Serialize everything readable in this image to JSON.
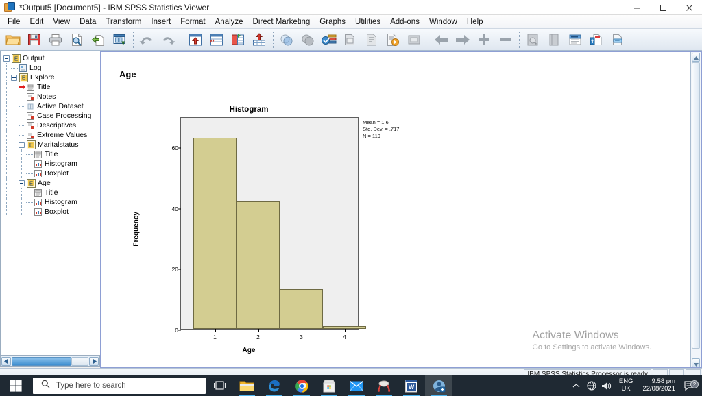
{
  "window": {
    "title": "*Output5 [Document5] - IBM SPSS Statistics Viewer",
    "app_icon": "spss-icon",
    "minimize_label": "—",
    "maximize_label": "☐",
    "close_label": "✕"
  },
  "menu": {
    "items": [
      {
        "label": "File",
        "accel": "F"
      },
      {
        "label": "Edit",
        "accel": "E"
      },
      {
        "label": "View",
        "accel": "V"
      },
      {
        "label": "Data",
        "accel": "D"
      },
      {
        "label": "Transform",
        "accel": "T"
      },
      {
        "label": "Insert",
        "accel": "I"
      },
      {
        "label": "Format",
        "accel": "o"
      },
      {
        "label": "Analyze",
        "accel": "A"
      },
      {
        "label": "Direct Marketing",
        "accel": "M"
      },
      {
        "label": "Graphs",
        "accel": "G"
      },
      {
        "label": "Utilities",
        "accel": "U"
      },
      {
        "label": "Add-ons",
        "accel": "n"
      },
      {
        "label": "Window",
        "accel": "W"
      },
      {
        "label": "Help",
        "accel": "H"
      }
    ]
  },
  "toolbar": {
    "buttons": [
      {
        "name": "open-file-icon",
        "title": "Open data document"
      },
      {
        "name": "save-icon",
        "title": "Save this document"
      },
      {
        "name": "print-icon",
        "title": "Print"
      },
      {
        "name": "print-preview-icon",
        "title": "Print preview"
      },
      {
        "name": "export-icon",
        "title": "Export"
      },
      {
        "name": "recall-dialog-icon",
        "title": "Recall recently used dialogs"
      },
      {
        "name": "undo-icon",
        "title": "Undo"
      },
      {
        "name": "redo-icon",
        "title": "Redo"
      },
      {
        "name": "goto-case-icon",
        "title": "Go to case"
      },
      {
        "name": "goto-variable-icon",
        "title": "Go to variable"
      },
      {
        "name": "variables-icon",
        "title": "Variables"
      },
      {
        "name": "insert-cases-icon",
        "title": "Insert cases"
      },
      {
        "name": "find-icon",
        "title": "Find"
      },
      {
        "name": "select-cases-icon",
        "title": "Select cases"
      },
      {
        "name": "value-labels-icon",
        "title": "Value labels"
      },
      {
        "name": "split-file-icon",
        "title": "Split file"
      },
      {
        "name": "weight-cases-icon",
        "title": "Weight cases"
      },
      {
        "name": "run-icon",
        "title": "Run"
      },
      {
        "name": "dialog-recall-icon",
        "title": "Dialog recall"
      },
      {
        "name": "back-arrow-icon",
        "title": "Back"
      },
      {
        "name": "forward-arrow-icon",
        "title": "Forward"
      },
      {
        "name": "expand-icon",
        "title": "Expand"
      },
      {
        "name": "collapse-icon",
        "title": "Collapse"
      },
      {
        "name": "preview-icon",
        "title": "Show/hide"
      },
      {
        "name": "book-icon",
        "title": "Hide"
      },
      {
        "name": "insert-text-icon",
        "title": "Insert new text"
      },
      {
        "name": "insert-title-icon",
        "title": "Insert new title"
      },
      {
        "name": "insert-page-break-icon",
        "title": "Insert page break"
      }
    ]
  },
  "outline": {
    "nodes": [
      {
        "label": "Output",
        "depth": 0,
        "icon": "output-icon",
        "expander": "open",
        "selected": false
      },
      {
        "label": "Log",
        "depth": 1,
        "icon": "log-icon",
        "expander": "none",
        "selected": false
      },
      {
        "label": "Explore",
        "depth": 1,
        "icon": "explore-icon",
        "expander": "open",
        "selected": false
      },
      {
        "label": "Title",
        "depth": 2,
        "icon": "title-icon",
        "expander": "none",
        "selected": true
      },
      {
        "label": "Notes",
        "depth": 2,
        "icon": "notes-icon",
        "expander": "none",
        "selected": false
      },
      {
        "label": "Active Dataset",
        "depth": 2,
        "icon": "dataset-icon",
        "expander": "none",
        "selected": false
      },
      {
        "label": "Case Processing",
        "depth": 2,
        "icon": "table-icon",
        "expander": "none",
        "selected": false
      },
      {
        "label": "Descriptives",
        "depth": 2,
        "icon": "table-icon",
        "expander": "none",
        "selected": false
      },
      {
        "label": "Extreme Values",
        "depth": 2,
        "icon": "table-icon",
        "expander": "none",
        "selected": false
      },
      {
        "label": "Maritalstatus",
        "depth": 2,
        "icon": "explore-icon",
        "expander": "open",
        "selected": false
      },
      {
        "label": "Title",
        "depth": 3,
        "icon": "title-icon",
        "expander": "none",
        "selected": false
      },
      {
        "label": "Histogram",
        "depth": 3,
        "icon": "chart-icon",
        "expander": "none",
        "selected": false
      },
      {
        "label": "Boxplot",
        "depth": 3,
        "icon": "chart-icon",
        "expander": "none",
        "selected": false
      },
      {
        "label": "Age",
        "depth": 2,
        "icon": "explore-icon",
        "expander": "open",
        "selected": false
      },
      {
        "label": "Title",
        "depth": 3,
        "icon": "title-icon",
        "expander": "none",
        "selected": false
      },
      {
        "label": "Histogram",
        "depth": 3,
        "icon": "chart-icon",
        "expander": "none",
        "selected": false
      },
      {
        "label": "Boxplot",
        "depth": 3,
        "icon": "chart-icon",
        "expander": "none",
        "selected": false
      }
    ]
  },
  "document": {
    "heading": "Age"
  },
  "chart_data": {
    "type": "bar",
    "title": "Histogram",
    "xlabel": "Age",
    "ylabel": "Frequency",
    "categories": [
      "1",
      "2",
      "3",
      "4"
    ],
    "values": [
      63,
      42,
      13,
      1
    ],
    "ylim": [
      0,
      70
    ],
    "yticks": [
      0,
      20,
      40,
      60
    ],
    "xticks": [
      "1",
      "2",
      "3",
      "4"
    ],
    "grid": false,
    "bar_color": "#d3cd91",
    "bar_border_color": "#6e6a43",
    "plot_background": "#efefef",
    "annotations": {
      "mean": "Mean = 1.6",
      "std_dev": "Std. Dev. = .717",
      "n": "N = 119"
    }
  },
  "watermark": {
    "line1": "Activate Windows",
    "line2": "Go to Settings to activate Windows."
  },
  "statusbar": {
    "message": "IBM SPSS Statistics Processor is ready"
  },
  "taskbar": {
    "start_icon": "windows-start-icon",
    "search_placeholder": "Type here to search",
    "search_icon": "search-icon",
    "items": [
      {
        "name": "task-view-icon",
        "label": "Task View"
      },
      {
        "name": "file-explorer-icon",
        "label": "File Explorer"
      },
      {
        "name": "edge-icon",
        "label": "Microsoft Edge"
      },
      {
        "name": "chrome-icon",
        "label": "Google Chrome"
      },
      {
        "name": "microsoft-store-icon",
        "label": "Microsoft Store"
      },
      {
        "name": "mail-icon",
        "label": "Mail"
      },
      {
        "name": "snip-sketch-icon",
        "label": "Snip & Sketch"
      },
      {
        "name": "word-icon",
        "label": "Microsoft Word"
      },
      {
        "name": "spss-icon",
        "label": "IBM SPSS Statistics Viewer"
      }
    ],
    "tray": {
      "chevron": "∧",
      "network_icon": "network-icon",
      "volume_icon": "volume-icon",
      "lang_line1": "ENG",
      "lang_line2": "UK",
      "time": "9:58 pm",
      "date": "22/08/2021",
      "notification_icon": "notification-icon",
      "notification_count": "2"
    }
  }
}
